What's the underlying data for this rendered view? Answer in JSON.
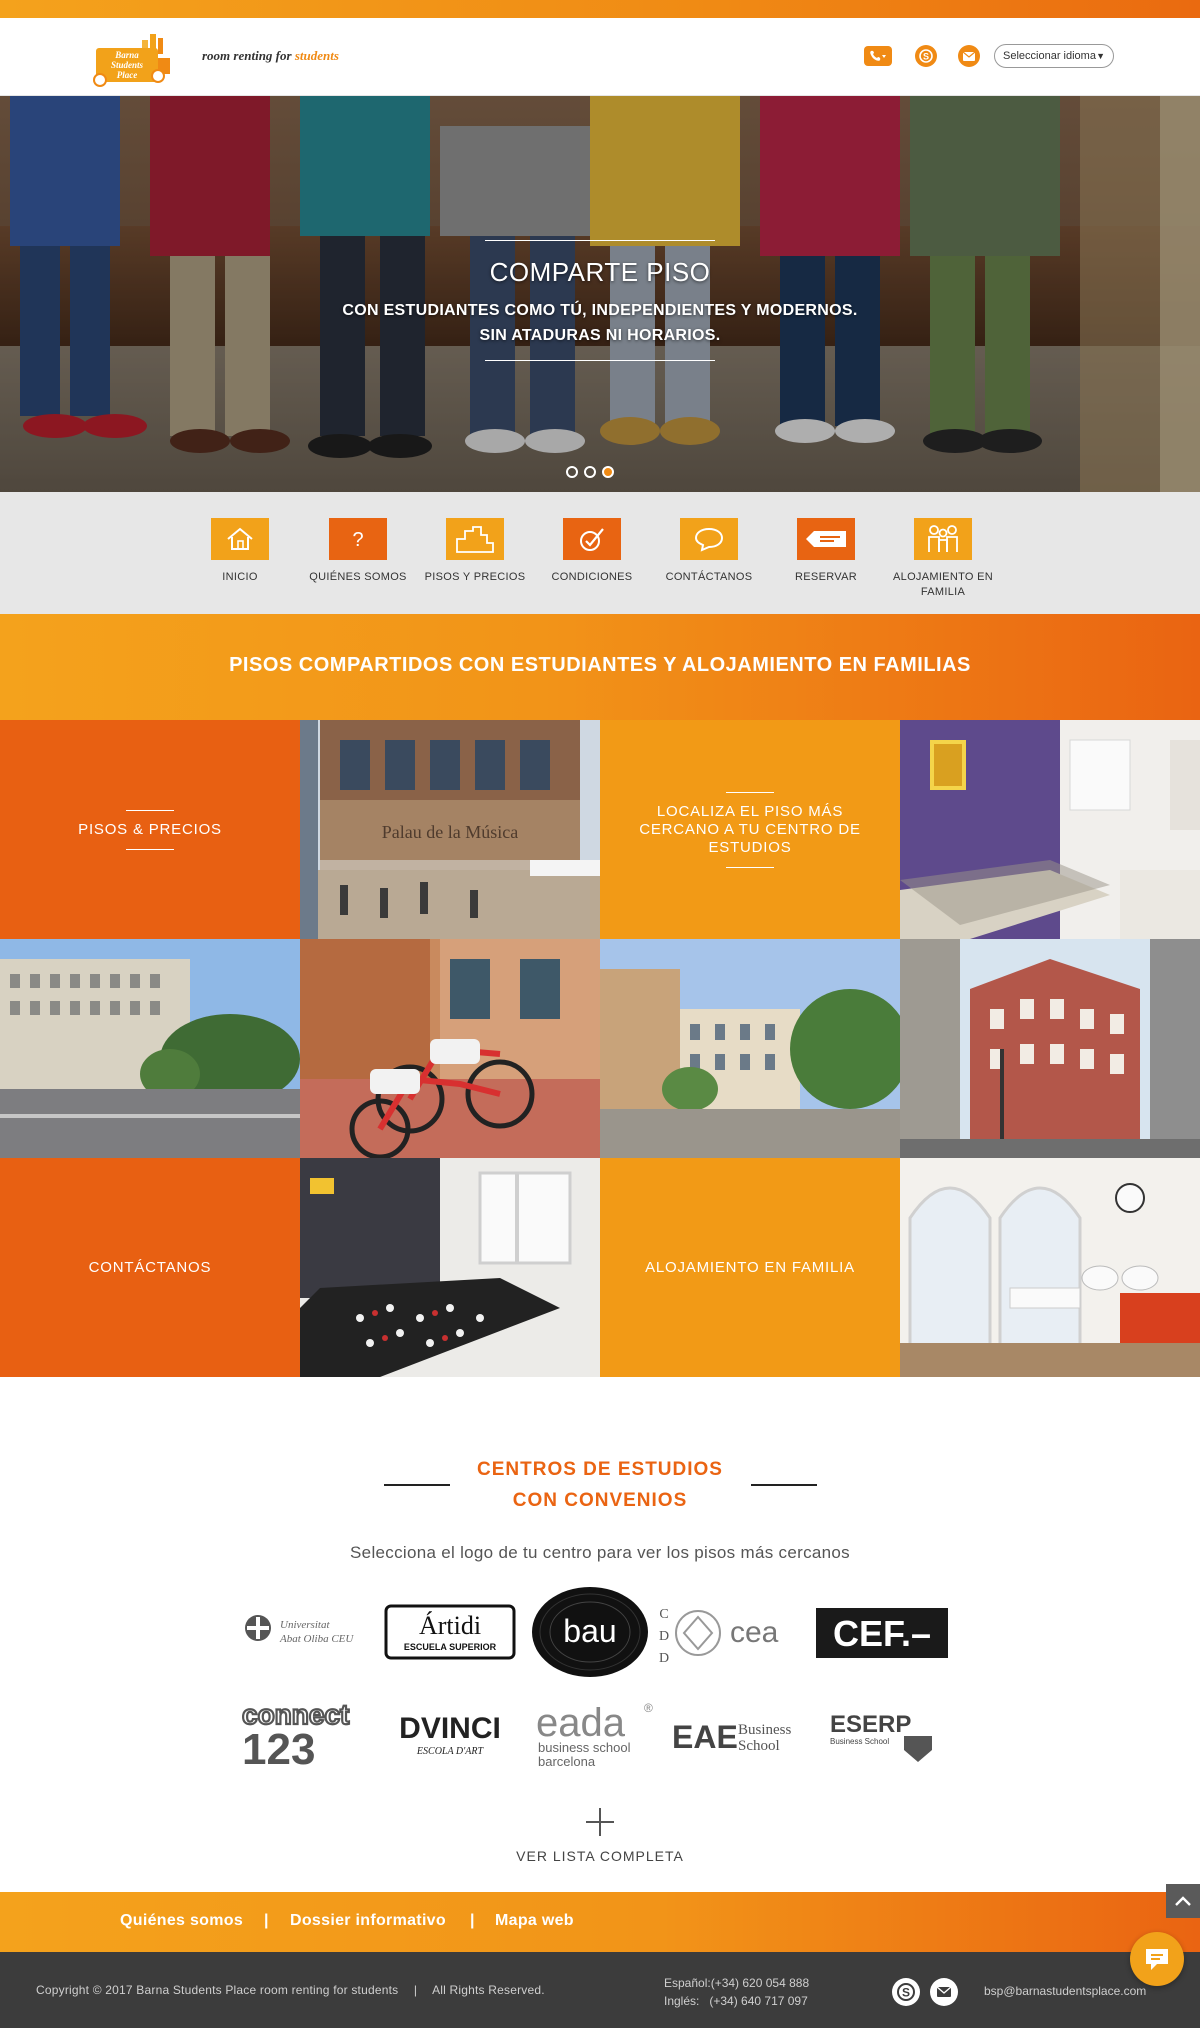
{
  "brand": {
    "logo_text": [
      "Barna",
      "Students",
      "Place"
    ],
    "tagline_prefix": "room renting for ",
    "tagline_accent": "students",
    "accent_color": "#f08a14",
    "dark_accent_color": "#ea6412"
  },
  "header": {
    "icons": [
      "phone-icon",
      "skype-icon",
      "mail-icon"
    ],
    "language_select": "Seleccionar idioma"
  },
  "hero": {
    "title": "COMPARTE PISO",
    "subtitle_line1": "CON ESTUDIANTES COMO TÚ, INDEPENDIENTES Y MODERNOS.",
    "subtitle_line2": "SIN ATADURAS NI HORARIOS.",
    "slides": 3,
    "active_slide": 3
  },
  "nav": {
    "items": [
      {
        "label": "INICIO",
        "icon": "home-icon"
      },
      {
        "label": "QUIÉNES SOMOS",
        "icon": "question-icon"
      },
      {
        "label": "PISOS Y PRECIOS",
        "icon": "buildings-icon"
      },
      {
        "label": "CONDICIONES",
        "icon": "checklist-icon"
      },
      {
        "label": "CONTÁCTANOS",
        "icon": "chat-bubble-icon"
      },
      {
        "label": "RESERVAR",
        "icon": "ticket-icon"
      },
      {
        "label": "ALOJAMIENTO EN FAMILIA",
        "icon": "family-icon"
      }
    ]
  },
  "banner": {
    "title": "PISOS COMPARTIDOS CON ESTUDIANTES Y ALOJAMIENTO EN FAMILIAS"
  },
  "tiles": {
    "pisos": "PISOS & PRECIOS",
    "localiza": "LOCALIZA EL PISO MÁS CERCANO A TU CENTRO DE ESTUDIOS",
    "contacto": "CONTÁCTANOS",
    "familia": "ALOJAMIENTO EN FAMILIA",
    "photo_caption": "Palau de la Música"
  },
  "centros": {
    "title_line1": "CENTROS DE ESTUDIOS",
    "title_line2": "CON CONVENIOS",
    "subtitle": "Selecciona el logo de tu centro para ver los pisos más cercanos",
    "logos": {
      "abat_line1": "Universitat",
      "abat_line2": "Abat Oliba CEU",
      "artidi": "Ártidi",
      "artidi_sub": "ESCUELA SUPERIOR",
      "bau": "bau",
      "cdd": [
        "C",
        "D",
        "D"
      ],
      "cea": "cea",
      "cef": "CEF.–",
      "connect1": "connect",
      "connect2": "123",
      "davinci": "DVINCI",
      "davinci_sub": "ESCOLA D'ART",
      "eada": "eada",
      "eada_sub1": "business school",
      "eada_sub2": "barcelona",
      "eae": "EAE",
      "eae_sub1": "Business",
      "eae_sub2": "School",
      "eserp": "ESERP",
      "eserp_sub": "Business School"
    },
    "more_label": "VER LISTA COMPLETA"
  },
  "footer": {
    "links": [
      "Quiénes somos",
      "Dossier informativo",
      "Mapa web"
    ],
    "separator": "|",
    "copyright": "Copyright © 2017 Barna Students Place room renting for students",
    "copyright_sep": "|",
    "rights": "All Rights Reserved.",
    "phone_es": "Español:(+34) 620 054 888",
    "phone_en": "Inglés:   (+34) 640 717 097",
    "email": "bsp@barnastudentsplace.com"
  }
}
